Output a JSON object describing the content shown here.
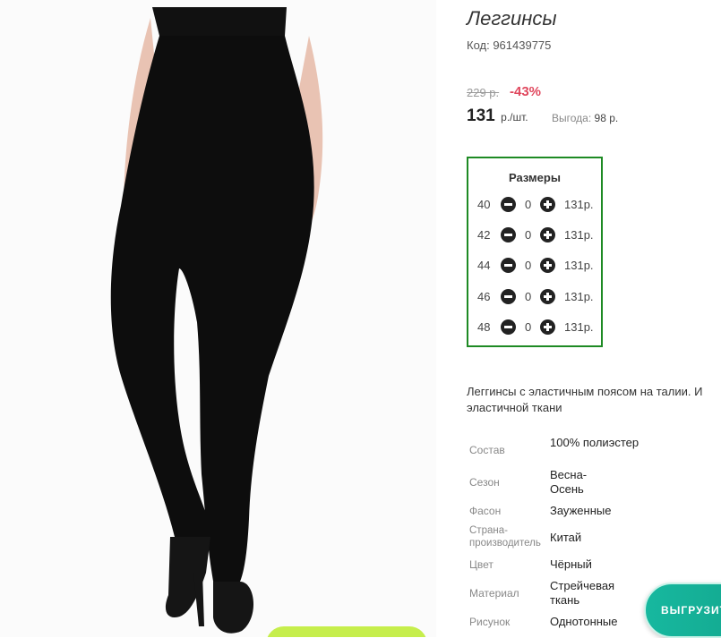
{
  "product": {
    "title": "Леггинсы",
    "code": "Код: 961439775",
    "old_price": "229 р.",
    "discount": "-43%",
    "price": "131",
    "unit": "р./шт.",
    "benefit_label": "Выгода:",
    "benefit_value": "98 р."
  },
  "sizes": {
    "title": "Размеры",
    "rows": [
      {
        "size": "40",
        "qty": "0",
        "price": "131р."
      },
      {
        "size": "42",
        "qty": "0",
        "price": "131р."
      },
      {
        "size": "44",
        "qty": "0",
        "price": "131р."
      },
      {
        "size": "46",
        "qty": "0",
        "price": "131р."
      },
      {
        "size": "48",
        "qty": "0",
        "price": "131р."
      }
    ]
  },
  "description": {
    "line1": "Леггинсы с эластичным поясом на талии. И",
    "line2": "эластичной ткани"
  },
  "attributes": [
    {
      "label": "Состав",
      "value": "100% полиэстер"
    },
    {
      "label": "Сезон",
      "value": "Весна-Осень"
    },
    {
      "label": "Фасон",
      "value": "Зауженные"
    },
    {
      "label": "Страна-производитель",
      "value": "Китай"
    },
    {
      "label": "Цвет",
      "value": "Чёрный"
    },
    {
      "label": "Материал",
      "value": "Стрейчевая ткань"
    },
    {
      "label": "Рисунок",
      "value": "Однотонные"
    }
  ],
  "upload_button": "ВЫГРУЗИТЬ",
  "colors": {
    "border_green": "#1e8a24",
    "discount_red": "#e0485e",
    "teal": "#17b89f",
    "lime": "#c6ee4c"
  }
}
